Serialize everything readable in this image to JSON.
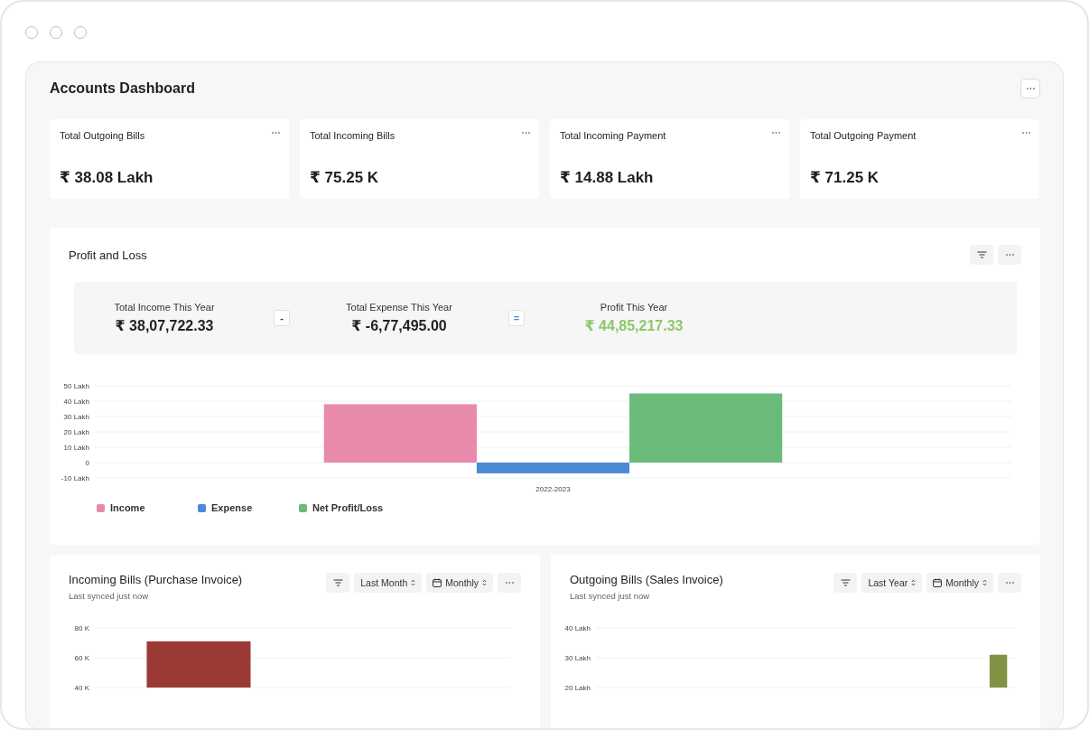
{
  "dashboard": {
    "title": "Accounts Dashboard"
  },
  "cards": [
    {
      "label": "Total Outgoing Bills",
      "value": "₹ 38.08 Lakh"
    },
    {
      "label": "Total Incoming Bills",
      "value": "₹ 75.25 K"
    },
    {
      "label": "Total Incoming Payment",
      "value": "₹ 14.88 Lakh"
    },
    {
      "label": "Total Outgoing Payment",
      "value": "₹ 71.25 K"
    }
  ],
  "profit_and_loss": {
    "title": "Profit and Loss",
    "summary": [
      {
        "kind": "amount",
        "label": "Total Income This Year",
        "value": "₹ 38,07,722.33"
      },
      {
        "kind": "operator",
        "symbol": "-"
      },
      {
        "kind": "amount",
        "label": "Total Expense This Year",
        "value": "₹ -6,77,495.00"
      },
      {
        "kind": "operator",
        "symbol": "="
      },
      {
        "kind": "result",
        "label": "Profit This Year",
        "value": "₹ 44,85,217.33"
      }
    ],
    "chart_data": {
      "type": "bar",
      "grid": true,
      "categories": [
        "2022-2023"
      ],
      "ylim": [
        -10,
        50
      ],
      "yticks": [
        {
          "value": -10,
          "label": "-10 Lakh"
        },
        {
          "value": 0,
          "label": "0"
        },
        {
          "value": 10,
          "label": "10 Lakh"
        },
        {
          "value": 20,
          "label": "20 Lakh"
        },
        {
          "value": 30,
          "label": "30 Lakh"
        },
        {
          "value": 40,
          "label": "40 Lakh"
        },
        {
          "value": 50,
          "label": "50 Lakh"
        }
      ],
      "series": [
        {
          "name": "Income",
          "color": "#e88aab",
          "values": [
            38
          ]
        },
        {
          "name": "Expense",
          "color": "#4a8ad6",
          "values": [
            -7
          ]
        },
        {
          "name": "Net Profit/Loss",
          "color": "#6aba7a",
          "values": [
            45
          ]
        }
      ]
    }
  },
  "bill_panels": [
    {
      "title": "Incoming Bills (Purchase Invoice)",
      "subtitle": "Last synced just now",
      "controls": [
        {
          "kind": "filter"
        },
        {
          "kind": "select",
          "label": "Last Month"
        },
        {
          "kind": "date-select",
          "label": "Monthly"
        },
        {
          "kind": "more"
        }
      ],
      "chart_data": {
        "type": "bar",
        "grid": true,
        "ylim": [
          40,
          80
        ],
        "yticks": [
          {
            "value": 40,
            "label": "40 K"
          },
          {
            "value": 60,
            "label": "60 K"
          },
          {
            "value": 80,
            "label": "80 K"
          }
        ],
        "series": [
          {
            "color": "#9b3a35",
            "values": [
              71,
              null
            ]
          }
        ]
      }
    },
    {
      "title": "Outgoing Bills (Sales Invoice)",
      "subtitle": "Last synced just now",
      "controls": [
        {
          "kind": "filter"
        },
        {
          "kind": "select",
          "label": "Last Year"
        },
        {
          "kind": "date-select",
          "label": "Monthly"
        },
        {
          "kind": "more"
        }
      ],
      "chart_data": {
        "type": "bar",
        "grid": true,
        "ylim": [
          20,
          40
        ],
        "yticks": [
          {
            "value": 20,
            "label": "20 Lakh"
          },
          {
            "value": 30,
            "label": "30 Lakh"
          },
          {
            "value": 40,
            "label": "40 Lakh"
          }
        ],
        "series": [
          {
            "color": "#829245",
            "values": [
              null,
              null,
              null,
              null,
              null,
              null,
              null,
              null,
              null,
              null,
              null,
              31
            ]
          }
        ]
      }
    }
  ]
}
